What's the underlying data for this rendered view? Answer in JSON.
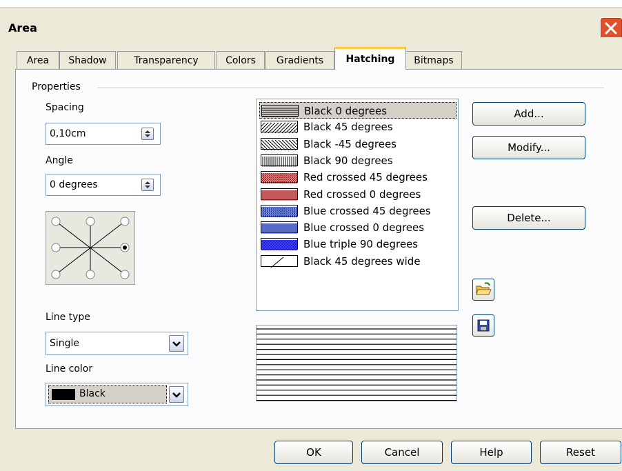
{
  "window": {
    "title": "Area"
  },
  "tabs": [
    {
      "label": "Area"
    },
    {
      "label": "Shadow"
    },
    {
      "label": "Transparency"
    },
    {
      "label": "Colors"
    },
    {
      "label": "Gradients"
    },
    {
      "label": "Hatching",
      "active": true
    },
    {
      "label": "Bitmaps"
    }
  ],
  "properties": {
    "group_label": "Properties",
    "spacing_label": "Spacing",
    "spacing_value": "0,10cm",
    "angle_label": "Angle",
    "angle_value": "0 degrees",
    "angle_selector_selected": "right",
    "line_type_label": "Line type",
    "line_type_value": "Single",
    "line_color_label": "Line color",
    "line_color_value": "Black",
    "line_color_swatch": "#000000"
  },
  "hatch_list": [
    {
      "label": "Black 0 degrees",
      "pattern": "h",
      "color": "#000000",
      "selected": true
    },
    {
      "label": "Black 45 degrees",
      "pattern": "d45",
      "color": "#000000"
    },
    {
      "label": "Black -45 degrees",
      "pattern": "dm45",
      "color": "#000000"
    },
    {
      "label": "Black 90 degrees",
      "pattern": "v",
      "color": "#000000"
    },
    {
      "label": "Red crossed 45 degrees",
      "pattern": "x45",
      "color": "#b22222"
    },
    {
      "label": "Red crossed 0 degrees",
      "pattern": "x0",
      "color": "#b22222"
    },
    {
      "label": "Blue crossed 45 degrees",
      "pattern": "x45",
      "color": "#1e3cb4"
    },
    {
      "label": "Blue crossed 0 degrees",
      "pattern": "x0",
      "color": "#1e3cb4"
    },
    {
      "label": "Blue triple 90 degrees",
      "pattern": "t90",
      "color": "#1e1ee6"
    },
    {
      "label": "Black 45 degrees wide",
      "pattern": "wide",
      "color": "#000000"
    }
  ],
  "buttons": {
    "add": "Add...",
    "modify": "Modify...",
    "delete": "Delete...",
    "ok": "OK",
    "cancel": "Cancel",
    "help": "Help",
    "reset": "Reset"
  },
  "icons": {
    "load": "open-folder-icon",
    "save": "save-disk-icon",
    "close": "close-icon"
  }
}
